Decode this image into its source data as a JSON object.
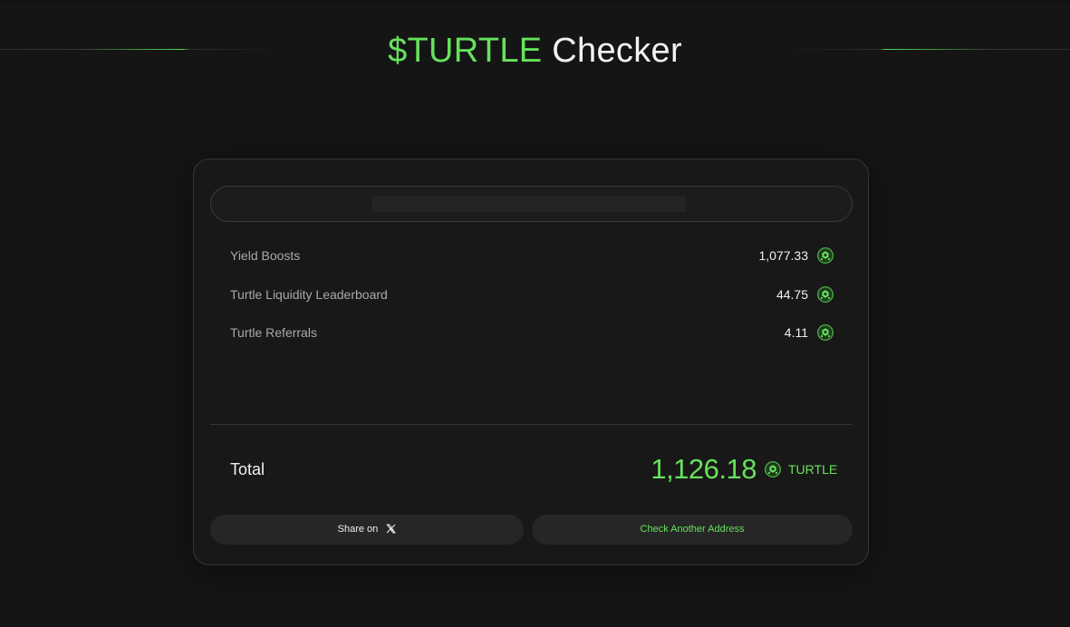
{
  "header": {
    "title_accent": "$TURTLE",
    "title_rest": " Checker"
  },
  "address": {
    "value": ""
  },
  "breakdown": [
    {
      "label": "Yield Boosts",
      "value": "1,077.33",
      "icon": "turtle-token-icon"
    },
    {
      "label": "Turtle Liquidity Leaderboard",
      "value": "44.75",
      "icon": "turtle-token-icon"
    },
    {
      "label": "Turtle Referrals",
      "value": "4.11",
      "icon": "turtle-token-icon"
    }
  ],
  "total": {
    "label": "Total",
    "value": "1,126.18",
    "unit": "TURTLE",
    "icon": "turtle-token-icon"
  },
  "actions": {
    "share_label": "Share on",
    "share_icon": "x-logo-icon",
    "check_label": "Check Another Address"
  },
  "colors": {
    "accent": "#66e25b",
    "background": "#151515",
    "card": "#181818",
    "button": "#262626"
  }
}
